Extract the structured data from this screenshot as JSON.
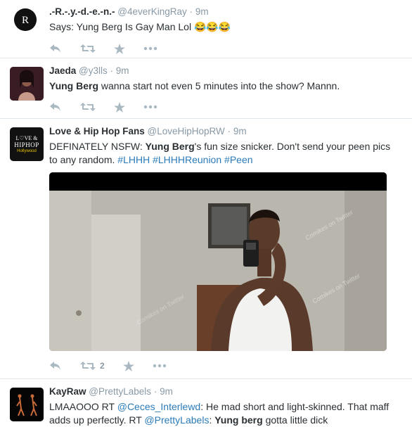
{
  "tweets": [
    {
      "name": ".-R.-.y.-d.-e.-n.-",
      "handle": "@4everKingRay",
      "dot": "·",
      "time": "9m",
      "text_plain": "Says: Yung Berg Is Gay Man Lol 😂😂😂",
      "avatar_icon": "r-monogram-icon"
    },
    {
      "name": "Jaeda",
      "handle": "@y3lls",
      "dot": "·",
      "time": "9m",
      "text_bold": "Yung Berg",
      "text_rest": " wanna start not even 5 minutes into the show? Mannn.",
      "avatar_icon": "profile-photo"
    },
    {
      "name": "Love & Hip Hop Fans",
      "handle": "@LoveHipHopRW",
      "dot": "·",
      "time": "9m",
      "text_a": "DEFINATELY NSFW: ",
      "text_bold": "Yung Berg",
      "text_b": "'s fun size snicker. Don't send your peen pics to any random. ",
      "hashtags": [
        "#LHHH",
        "#LHHHReunion",
        "#Peen"
      ],
      "avatar_logo": {
        "l1": "L♡VE &",
        "l2": "HIPHOP",
        "l3": "Hollywood"
      },
      "retweet_count": "2",
      "media_watermarks": [
        "Comikes on Twitter",
        "Comikes on Twitter",
        "Comikes on Twitter"
      ]
    },
    {
      "name": "KayRaw",
      "handle": "@PrettyLabels",
      "dot": "·",
      "time": "9m",
      "text_a": "LMAAOOO RT ",
      "mention1": "@Ceces_Interlewd",
      "text_b": ": He mad short and light-skinned. That maff adds up perfectly. RT ",
      "mention2": "@PrettyLabels",
      "text_c": ": ",
      "text_bold": "Yung berg",
      "text_d": " gotta little dick"
    }
  ],
  "colors": {
    "link": "#2b7bb9",
    "muted": "#8899a6",
    "icon": "#aab8c2",
    "divider": "#e1e8ed"
  }
}
